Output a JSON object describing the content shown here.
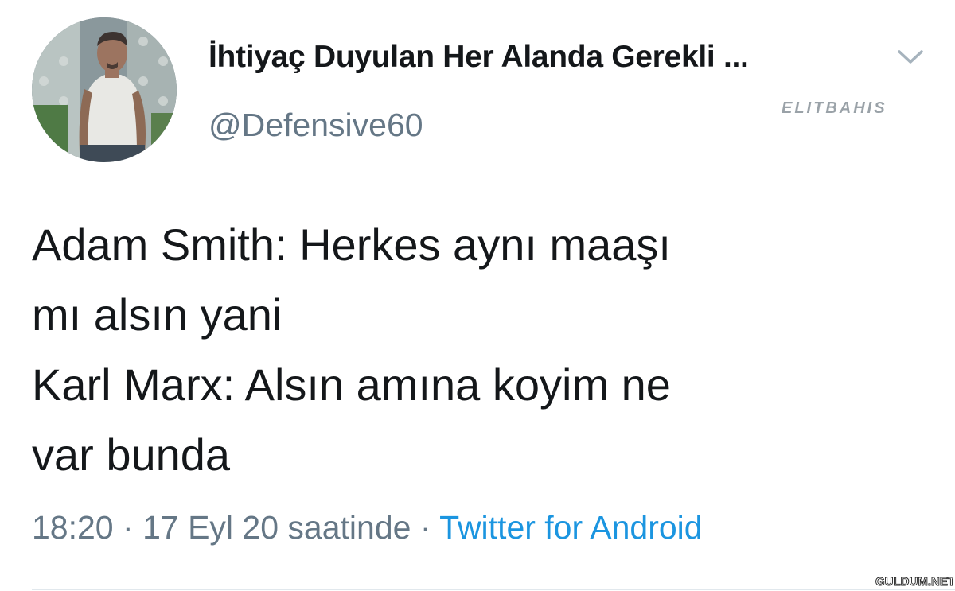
{
  "tweet": {
    "author": {
      "display_name": "İhtiyaç Duyulan Her Alanda Gerekli ...",
      "username": "@Defensive60",
      "avatar_icon": "profile-photo"
    },
    "text_lines": [
      "Adam Smith: Herkes aynı maaşı",
      "mı alsın yani",
      "Karl Marx: Alsın amına koyim ne",
      "var bunda"
    ],
    "time": "18:20",
    "separator": "·",
    "date": "17 Eyl 20 saatinde",
    "separator2": "·",
    "source": "Twitter for Android",
    "menu_icon": "chevron-down-icon"
  },
  "watermarks": {
    "top": "ELITBAHIS",
    "bottom": "GULDUM.NET"
  },
  "colors": {
    "text": "#14171a",
    "secondary": "#657786",
    "link": "#1b95e0",
    "divider": "#e1e8ed"
  }
}
